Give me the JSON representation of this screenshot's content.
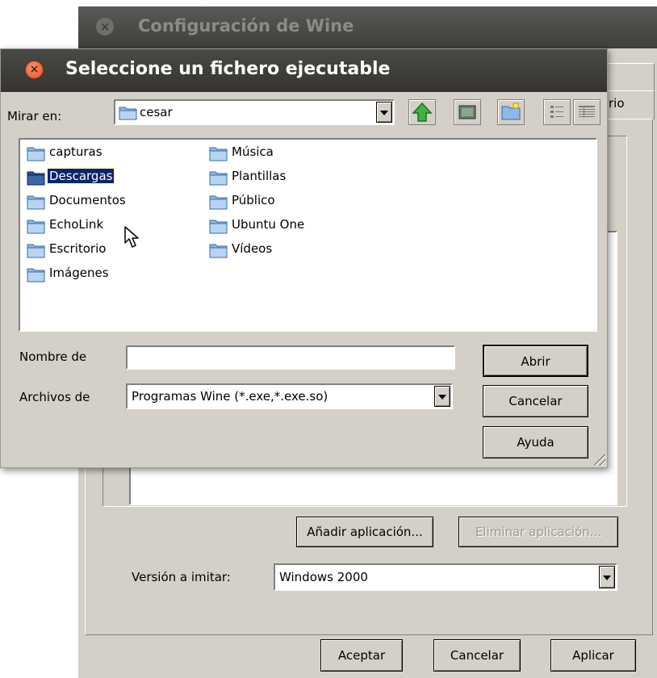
{
  "background_window": {
    "title": "Configuración de Wine",
    "tab_partial_label": "rio",
    "buttons": {
      "add_app": "Añadir aplicación...",
      "remove_app": "Eliminar aplicación...",
      "ok": "Aceptar",
      "cancel": "Cancelar",
      "apply": "Aplicar"
    },
    "version_label": "Versión a imitar:",
    "version_value": "Windows 2000"
  },
  "dialog": {
    "title": "Seleccione un fichero ejecutable",
    "look_in_label": "Mirar en:",
    "look_in_value": "cesar",
    "files": [
      {
        "name": "capturas"
      },
      {
        "name": "Descargas",
        "selected": true
      },
      {
        "name": "Documentos"
      },
      {
        "name": "EchoLink"
      },
      {
        "name": "Escritorio"
      },
      {
        "name": "Imágenes"
      },
      {
        "name": "Música"
      },
      {
        "name": "Plantillas"
      },
      {
        "name": "Público"
      },
      {
        "name": "Ubuntu One"
      },
      {
        "name": "Vídeos"
      }
    ],
    "filename_label": "Nombre de",
    "filename_value": "",
    "filetype_label": "Archivos de",
    "filetype_value": "Programas Wine (*.exe,*.exe.so)",
    "buttons": {
      "open": "Abrir",
      "cancel": "Cancelar",
      "help": "Ayuda"
    }
  },
  "colors": {
    "selection": "#0a246a",
    "window_bg": "#d4d0c8",
    "close_button": "#e05426"
  }
}
